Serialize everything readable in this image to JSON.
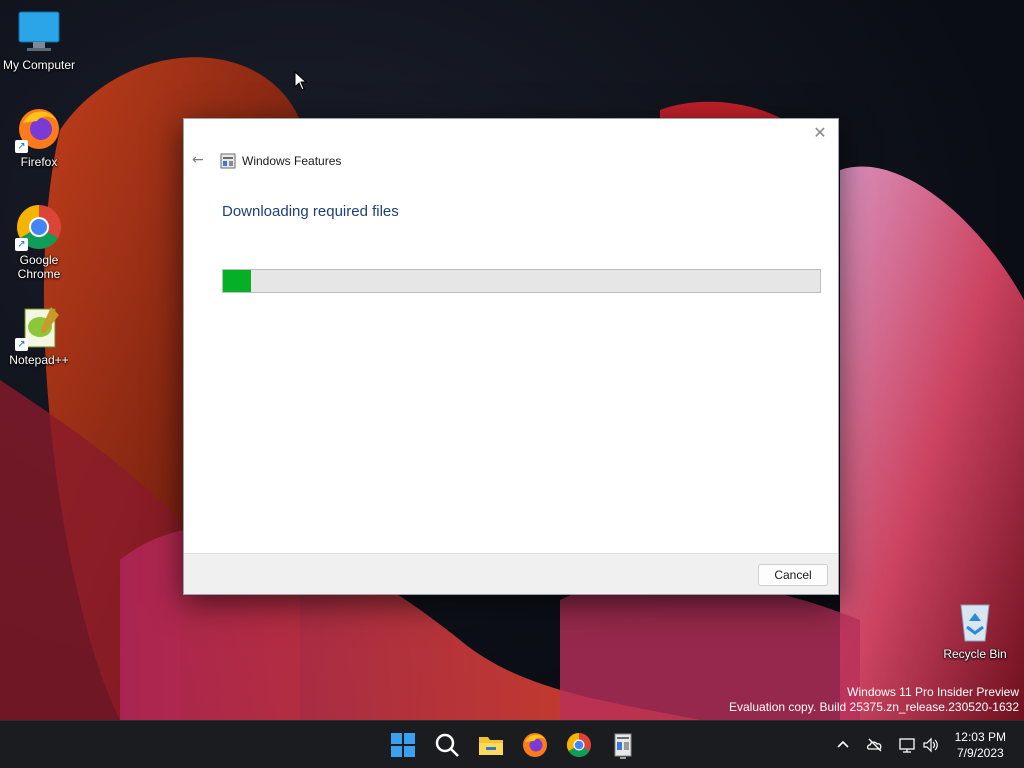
{
  "desktop": {
    "icons": [
      {
        "label": "My Computer"
      },
      {
        "label": "Firefox"
      },
      {
        "label": "Google\nChrome"
      },
      {
        "label": "Notepad++"
      },
      {
        "label": "Recycle Bin"
      }
    ],
    "watermark": {
      "line1": "Windows 11 Pro Insider Preview",
      "line2": "Evaluation copy. Build 25375.zn_release.230520-1632"
    }
  },
  "dialog": {
    "title": "Windows Features",
    "heading": "Downloading required files",
    "progress_percent": 4.7,
    "cancel_label": "Cancel",
    "close_glyph": "✕",
    "back_glyph": "←"
  },
  "taskbar": {
    "apps": [
      "start-icon",
      "search-icon",
      "file-explorer-icon",
      "firefox-icon",
      "chrome-icon",
      "windows-features-icon"
    ],
    "clock": {
      "time": "12:03 PM",
      "date": "7/9/2023"
    }
  },
  "colors": {
    "progress_fill": "#06b025",
    "heading": "#1e3f7a"
  }
}
